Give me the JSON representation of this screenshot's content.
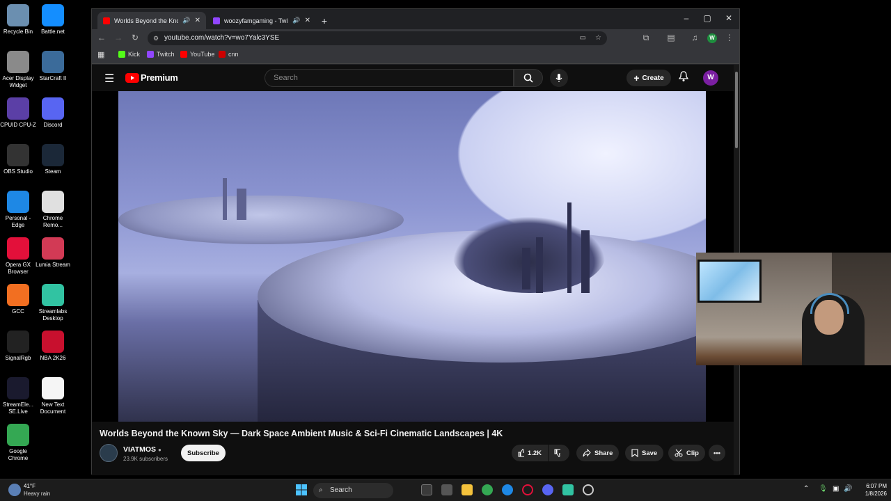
{
  "desktop": {
    "icons": [
      {
        "label": "Recycle Bin",
        "color": "#6b8fb0"
      },
      {
        "label": "Battle.net",
        "color": "#148eff"
      },
      {
        "label": "Acer Display Widget",
        "color": "#8a8a8a"
      },
      {
        "label": "StarCraft II",
        "color": "#3b6b9a"
      },
      {
        "label": "CPUID CPU-Z",
        "color": "#5b3fa6"
      },
      {
        "label": "Discord",
        "color": "#5865f2"
      },
      {
        "label": "OBS Studio",
        "color": "#333333"
      },
      {
        "label": "Steam",
        "color": "#1b2838"
      },
      {
        "label": "Personal - Edge",
        "color": "#1e88e5"
      },
      {
        "label": "Chrome Remo...",
        "color": "#e0e0e0"
      },
      {
        "label": "Opera GX Browser",
        "color": "#e3103a"
      },
      {
        "label": "Lumia Stream",
        "color": "#d23a55"
      },
      {
        "label": "GCC",
        "color": "#f26f21"
      },
      {
        "label": "Streamlabs Desktop",
        "color": "#31c3a2"
      },
      {
        "label": "SignalRgb",
        "color": "#222222"
      },
      {
        "label": "NBA 2K26",
        "color": "#c8102e"
      },
      {
        "label": "StreamEle... SE.Live",
        "color": "#1a1a2e"
      },
      {
        "label": "New Text Document",
        "color": "#f5f5f5"
      },
      {
        "label": "Google Chrome",
        "color": "#34a853"
      }
    ]
  },
  "browser": {
    "tabs": [
      {
        "title": "Worlds Beyond the Known",
        "active": true,
        "favicon_color": "#ff0000"
      },
      {
        "title": "woozyfamgaming - Twitch",
        "active": false,
        "favicon_color": "#9146ff"
      }
    ],
    "new_tab": "+",
    "url": "youtube.com/watch?v=wo7Yalc3YSE",
    "profile_initial": "W",
    "bookmarks": [
      {
        "label": "Kick",
        "color": "#53fc18"
      },
      {
        "label": "Twitch",
        "color": "#9146ff"
      },
      {
        "label": "YouTube",
        "color": "#ff0000"
      },
      {
        "label": "cnn",
        "color": "#cc0000"
      }
    ]
  },
  "youtube": {
    "logo_text": "Premium",
    "search_placeholder": "Search",
    "create_label": "Create",
    "avatar_initial": "W",
    "video_title": "Worlds Beyond the Known Sky — Dark Space Ambient Music & Sci-Fi Cinematic Landscapes | 4K",
    "channel_name": "VIATMOS",
    "subscribers": "23.9K subscribers",
    "subscribe_label": "Subscribe",
    "likes": "1.2K",
    "share_label": "Share",
    "save_label": "Save",
    "clip_label": "Clip"
  },
  "taskbar": {
    "weather_temp": "41°F",
    "weather_desc": "Heavy rain",
    "search_label": "Search",
    "time": "6:07 PM",
    "date": "1/8/2026"
  }
}
